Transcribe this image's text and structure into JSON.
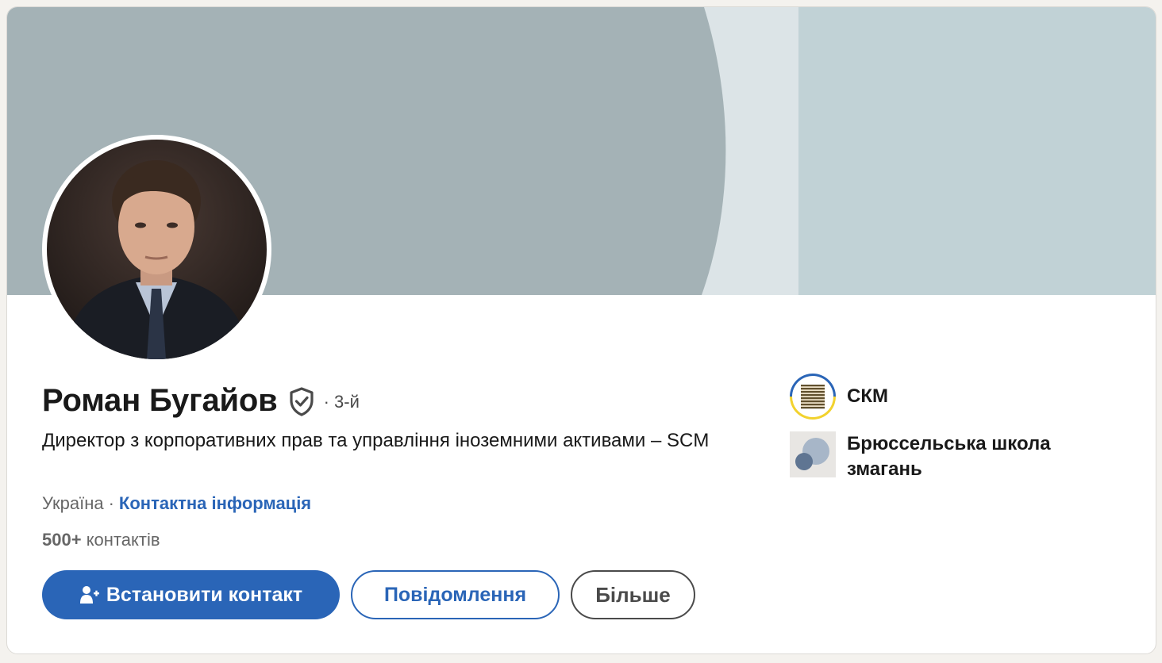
{
  "profile": {
    "name": "Роман Бугайов",
    "degree": "· 3-й",
    "headline": "Директор з корпоративних прав та управління іноземними активами – SCM",
    "location": "Україна",
    "location_separator": "·",
    "contact_info_label": "Контактна інформація",
    "connections_count": "500+",
    "connections_label": "контактів"
  },
  "actions": {
    "connect_label": "Встановити контакт",
    "message_label": "Повідомлення",
    "more_label": "Більше"
  },
  "organizations": [
    {
      "name": "СКМ",
      "logo_icon": "scm-logo-icon"
    },
    {
      "name": "Брюссельська школа змагань",
      "logo_icon": "school-logo-icon"
    }
  ],
  "colors": {
    "accent": "#2a65b7",
    "banner_primary": "#a4b2b6",
    "banner_light": "#dce4e7",
    "banner_right": "#c1d2d6"
  },
  "icons": {
    "verified": "verified-shield-icon",
    "connect": "add-person-icon"
  }
}
